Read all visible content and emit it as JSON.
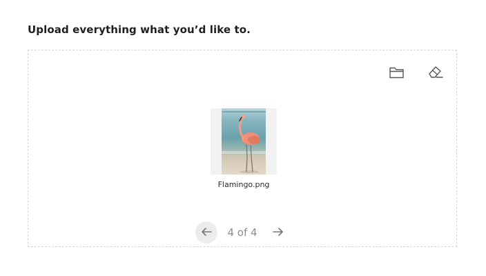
{
  "heading": "Upload everything what you’d like to.",
  "toolbar": {
    "folder_icon": "folder-open-icon",
    "eraser_icon": "eraser-icon"
  },
  "file": {
    "name": "Flamingo.png",
    "thumbnail_icon": "flamingo-thumbnail"
  },
  "pager": {
    "label": "4 of 4",
    "prev_icon": "arrow-left-icon",
    "next_icon": "arrow-right-icon"
  },
  "colors": {
    "text": "#1f1f1f",
    "muted": "#8c8c8c",
    "border": "#d6d6d6",
    "card_bg": "#f2f2f2"
  }
}
